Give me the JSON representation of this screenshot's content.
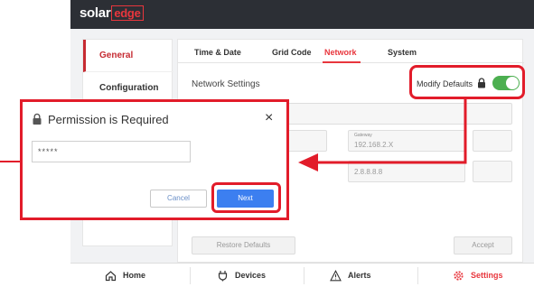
{
  "brand": {
    "logo_main": "solar",
    "logo_edge": "edge"
  },
  "nav": {
    "items": [
      {
        "label": "General"
      },
      {
        "label": "Configuration"
      }
    ]
  },
  "tabs": [
    {
      "label": "Time & Date"
    },
    {
      "label": "Grid Code"
    },
    {
      "label": "Network"
    },
    {
      "label": "System"
    }
  ],
  "network": {
    "title": "Network Settings",
    "modify_defaults_label": "Modify Defaults",
    "toggle_on": true,
    "gateway_label": "Gateway",
    "gateway_value": "192.168.2.X",
    "dns_value": "2.8.8.8.8"
  },
  "actions": {
    "restore_defaults": "Restore Defaults",
    "accept": "Accept"
  },
  "bottom_nav": [
    {
      "label": "Home"
    },
    {
      "label": "Devices"
    },
    {
      "label": "Alerts"
    },
    {
      "label": "Settings"
    }
  ],
  "dialog": {
    "title": "Permission is Required",
    "password_value": "*****",
    "cancel_label": "Cancel",
    "next_label": "Next"
  },
  "colors": {
    "accent": "#e8363d",
    "highlight": "#e21c2a",
    "primary_button": "#3c7ff0",
    "toggle": "#4caf50"
  },
  "icons": [
    "lock-icon",
    "close-icon",
    "home-icon",
    "devices-icon",
    "alert-icon",
    "settings-icon"
  ]
}
